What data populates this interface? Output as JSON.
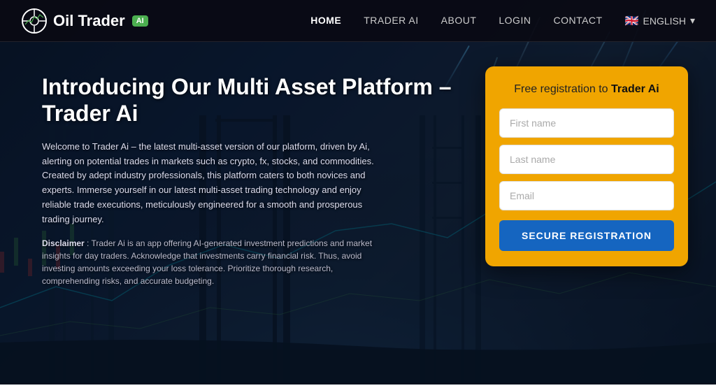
{
  "brand": {
    "name": "Oil Trader",
    "badge": "AI",
    "logo_icon_symbol": "⊙"
  },
  "navbar": {
    "links": [
      {
        "label": "HOME",
        "active": true
      },
      {
        "label": "TRADER AI",
        "active": false
      },
      {
        "label": "ABOUT",
        "active": false
      },
      {
        "label": "LOGIN",
        "active": false
      },
      {
        "label": "CONTACT",
        "active": false
      }
    ],
    "language": {
      "flag": "🇬🇧",
      "label": "ENGLISH",
      "chevron": "▾"
    }
  },
  "hero": {
    "heading": "Introducing Our Multi Asset Platform – Trader Ai",
    "description": "Welcome to Trader Ai – the latest multi-asset version of our platform, driven by Ai, alerting on potential trades in markets such as crypto, fx, stocks, and commodities. Created by adept industry professionals, this platform caters to both novices and experts. Immerse yourself in our latest multi-asset trading technology and enjoy reliable trade executions, meticulously engineered for a smooth and prosperous trading journey.",
    "disclaimer_label": "Disclaimer",
    "disclaimer_text": ": Trader Ai is an app offering AI-generated investment predictions and market insights for day traders. Acknowledge that investments carry financial risk. Thus, avoid investing amounts exceeding your loss tolerance. Prioritize thorough research, comprehending risks, and accurate budgeting."
  },
  "registration": {
    "title_prefix": "Free registration to",
    "title_brand": "Trader Ai",
    "fields": [
      {
        "id": "first-name",
        "placeholder": "First name"
      },
      {
        "id": "last-name",
        "placeholder": "Last name"
      },
      {
        "id": "email",
        "placeholder": "Email"
      }
    ],
    "button_label": "SECURE REGISTRATION"
  }
}
